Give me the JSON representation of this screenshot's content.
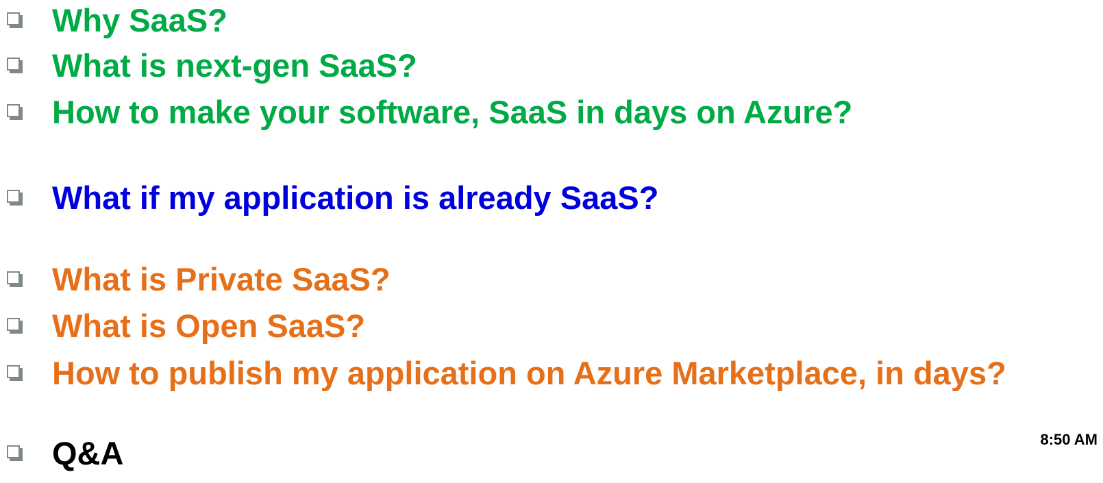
{
  "colors": {
    "green": "#00aa44",
    "blue": "#0000dd",
    "orange": "#e6701a",
    "black": "#000000"
  },
  "agenda": [
    {
      "text": "Why SaaS?",
      "color": "#00aa44"
    },
    {
      "text": "What is next-gen SaaS?",
      "color": "#00aa44"
    },
    {
      "text": "How to make your software, SaaS in days on Azure?",
      "color": "#00aa44"
    },
    {
      "text": "What if my application is already SaaS?",
      "color": "#0000dd"
    },
    {
      "text": "What is Private SaaS?",
      "color": "#e6701a"
    },
    {
      "text": "What is Open SaaS?",
      "color": "#e6701a"
    },
    {
      "text": "How to publish my application on Azure Marketplace, in days?",
      "color": "#e6701a"
    },
    {
      "text": "Q&A",
      "color": "#000000"
    }
  ],
  "clock": "8:50 AM",
  "icons": {
    "bullet": "checkbox-icon"
  }
}
